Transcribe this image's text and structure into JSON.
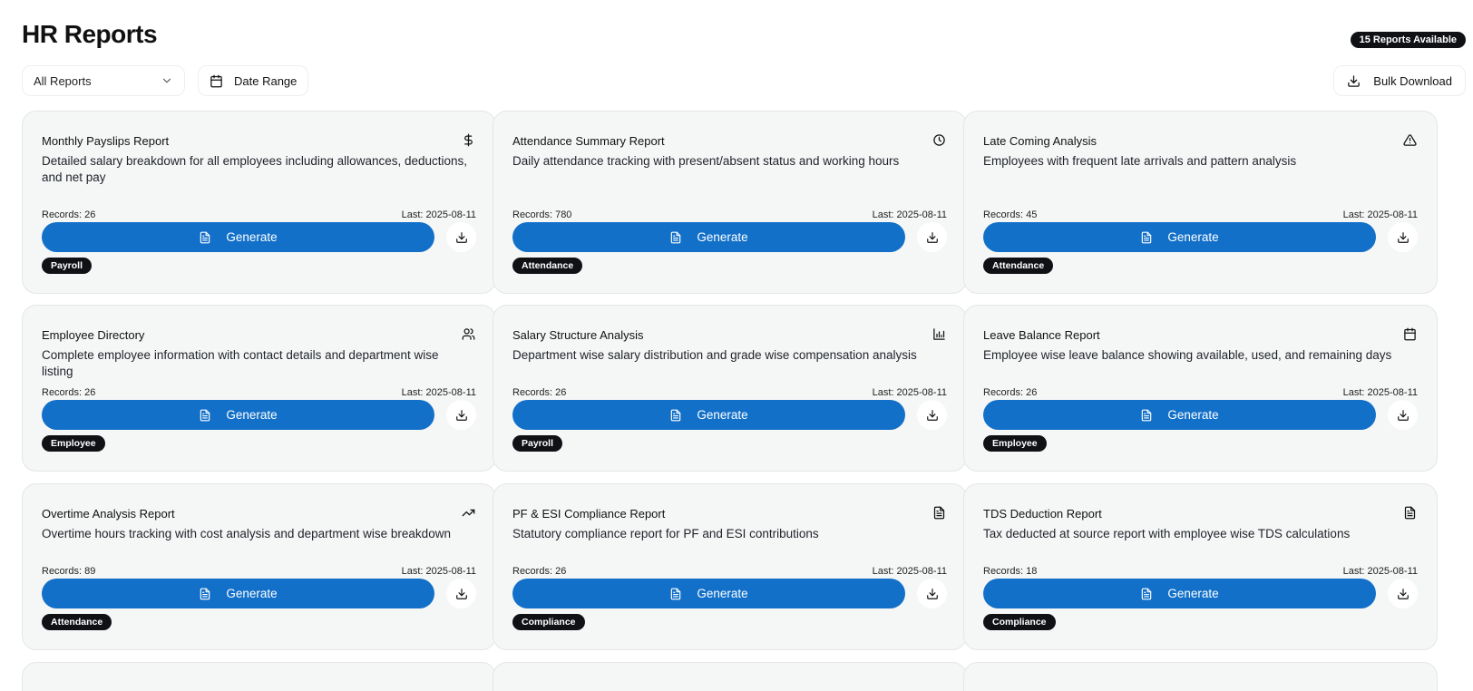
{
  "page": {
    "title": "HR Reports",
    "count_badge": "15 Reports Available",
    "filter_label": "All Reports",
    "date_range_label": "Date Range",
    "bulk_download_label": "Bulk Download",
    "generate_label": "Generate"
  },
  "colors": {
    "primary": "#1270c9",
    "tag_bg": "#0f1115",
    "card_bg": "#f5f6f6"
  },
  "reports": [
    {
      "title": "Monthly Payslips Report",
      "icon": "dollar-icon",
      "description": "Detailed salary breakdown for all employees including allowances, deductions, and net pay",
      "records": "Records: 26",
      "last": "Last: 2025-08-11",
      "tag": "Payroll"
    },
    {
      "title": "Attendance Summary Report",
      "icon": "clock-icon",
      "description": "Daily attendance tracking with present/absent status and working hours",
      "records": "Records: 780",
      "last": "Last: 2025-08-11",
      "tag": "Attendance"
    },
    {
      "title": "Late Coming Analysis",
      "icon": "warning-icon",
      "description": "Employees with frequent late arrivals and pattern analysis",
      "records": "Records: 45",
      "last": "Last: 2025-08-11",
      "tag": "Attendance"
    },
    {
      "title": "Employee Directory",
      "icon": "users-icon",
      "description": "Complete employee information with contact details and department wise listing",
      "records": "Records: 26",
      "last": "Last: 2025-08-11",
      "tag": "Employee"
    },
    {
      "title": "Salary Structure Analysis",
      "icon": "bar-chart-icon",
      "description": "Department wise salary distribution and grade wise compensation analysis",
      "records": "Records: 26",
      "last": "Last: 2025-08-11",
      "tag": "Payroll"
    },
    {
      "title": "Leave Balance Report",
      "icon": "calendar-icon",
      "description": "Employee wise leave balance showing available, used, and remaining days",
      "records": "Records: 26",
      "last": "Last: 2025-08-11",
      "tag": "Employee"
    },
    {
      "title": "Overtime Analysis Report",
      "icon": "trending-up-icon",
      "description": "Overtime hours tracking with cost analysis and department wise breakdown",
      "records": "Records: 89",
      "last": "Last: 2025-08-11",
      "tag": "Attendance"
    },
    {
      "title": "PF & ESI Compliance Report",
      "icon": "file-icon",
      "description": "Statutory compliance report for PF and ESI contributions",
      "records": "Records: 26",
      "last": "Last: 2025-08-11",
      "tag": "Compliance"
    },
    {
      "title": "TDS Deduction Report",
      "icon": "file-icon",
      "description": "Tax deducted at source report with employee wise TDS calculations",
      "records": "Records: 18",
      "last": "Last: 2025-08-11",
      "tag": "Compliance"
    }
  ]
}
